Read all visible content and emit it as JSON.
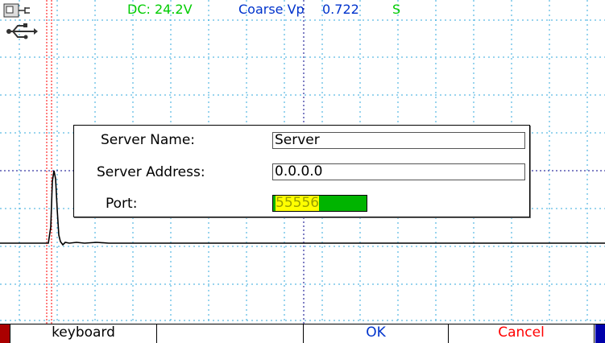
{
  "status_bar": {
    "dc_reading": "DC: 24.2V",
    "range_mode": "Coarse Vp",
    "value": "0.722",
    "unit": "S",
    "colors": {
      "dc": "#00cc00",
      "range": "#0033cc",
      "value": "#0033cc",
      "unit": "#00cc00"
    }
  },
  "icons": [
    "power-plug-icon",
    "usb-icon"
  ],
  "dialog": {
    "server_name_label": "Server Name:",
    "server_name_value": "Server",
    "server_address_label": "Server Address:",
    "server_address_value": "0.0.0.0",
    "port_label": "Port:",
    "port_value": "55556"
  },
  "softkeys": {
    "keyboard_label": "keyboard",
    "key2_label": "",
    "ok_label": "OK",
    "cancel_label": "Cancel",
    "colors": {
      "ok": "#0033cc",
      "cancel": "#ff0000",
      "left_edge": "#aa0000",
      "right_edge": "#0000aa"
    }
  },
  "colors": {
    "grid": "#33aadd",
    "trace": "#000000",
    "marker": "#ff0000"
  }
}
